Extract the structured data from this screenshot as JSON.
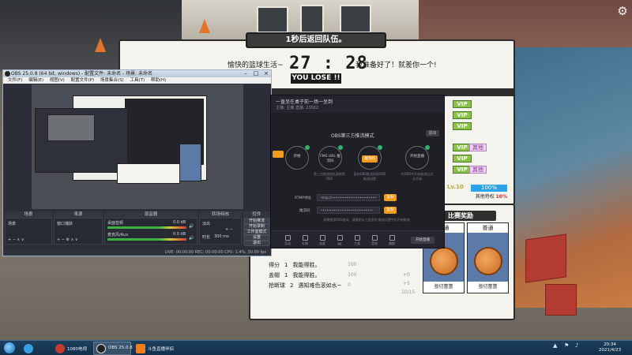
{
  "game": {
    "toast": "1秒后返回队伍。",
    "team_left": "愉快的篮球生活~",
    "team_right": "我准备好了！就差你一个!",
    "score": "27 : 28",
    "result": "YOU LOSE !!",
    "vip_label": "VIP",
    "other_label": "其他",
    "level": "Lv.10",
    "progress_percent": "100%",
    "progress_value": 100,
    "progress_caption_prefix": "其他特权",
    "progress_caption_value": "10%",
    "reward_title": "比赛奖励",
    "reward_cards": [
      {
        "label": "普通",
        "footer": "普切蕾蕾"
      },
      {
        "label": "普通",
        "footer": "普切蕾蕾"
      }
    ],
    "stats": [
      {
        "name": "得分",
        "count": "1",
        "text": "我能得胜。"
      },
      {
        "name": "盖帽",
        "count": "1",
        "text": "我能得胜。"
      },
      {
        "name": "抢断球",
        "count": "2",
        "text": "遇知难色滚如水~"
      }
    ],
    "stat_faint": [
      "100",
      "100",
      "+0",
      "+5",
      "10/15",
      "0"
    ]
  },
  "obs": {
    "title": "OBS 25.0.8 (64 bit, windows) - 配置文件: 未命名 - 场景: 未命名",
    "menu": [
      "文件(F)",
      "编辑(E)",
      "视图(V)",
      "配置文件(P)",
      "场景集合(S)",
      "工具(T)",
      "帮助(H)"
    ],
    "docks": [
      "场景",
      "来源",
      "混音器",
      "转场特效",
      "控件"
    ],
    "scene_item": "场景",
    "source_item": "窗口捕获",
    "mixer": [
      {
        "name": "桌面音频",
        "level": "0.0 dB"
      },
      {
        "name": "麦克风/Aux",
        "level": "0.0 dB"
      }
    ],
    "transition": {
      "type": "淡出",
      "duration_label": "时长",
      "duration": "300 ms"
    },
    "controls": [
      "开始推流",
      "开始录制",
      "工作室模式",
      "设置",
      "退出"
    ],
    "status": "LIVE: 00:00:00   REC: 00:00:00   CPU: 1.4%, 30.00 fps"
  },
  "stream_app": {
    "title": "一直坐在桌子前一场一坐到",
    "subtitle": "主播: 主播      直播: 23562",
    "mode_title": "OBS第三方推流模式",
    "exit": "退出",
    "steps": [
      {
        "label": "开始",
        "desc": "开始直播按钮"
      },
      {
        "label": "FMS URL\n推流码",
        "desc": "第三方推流地址复制到OBS"
      },
      {
        "label": "推流码",
        "desc": "复制OBS推流码到OBS推流设置"
      },
      {
        "label": "开始直播",
        "desc": "在OBS中开始推流后点击开始"
      }
    ],
    "rtmp_label": "RTMP地址",
    "rtmp_value": "rtmp://••••••••••••••••••••••••",
    "key_label": "推流码",
    "key_value": "••••••••••••••••••••••••••••",
    "copy": "复制",
    "note": "如需使用OBS推流，请复制以上信息到 推流设置中后开始推流",
    "bottom_tools": [
      "互动",
      "礼物",
      "连麦",
      "PK",
      "工具",
      "音效",
      "美颜"
    ],
    "go_live": "开始直播"
  },
  "taskbar": {
    "apps": [
      {
        "label": "",
        "icon": "360-icon",
        "color": "#37a0e6"
      },
      {
        "label": "1080电视",
        "icon": "video-icon",
        "color": "#c33c2e"
      },
      {
        "label": "OBS 25.0.8",
        "icon": "obs-icon",
        "color": "#202020"
      },
      {
        "label": "斗鱼直播伴侣",
        "icon": "douyu-icon",
        "color": "#f07d1b"
      }
    ],
    "clock_time": "20:34",
    "clock_date": "2021/4/23"
  },
  "colors": {
    "accent_orange": "#f29b1e",
    "vip_green": "#8bc34a",
    "progress_blue": "#2ba3e8"
  }
}
